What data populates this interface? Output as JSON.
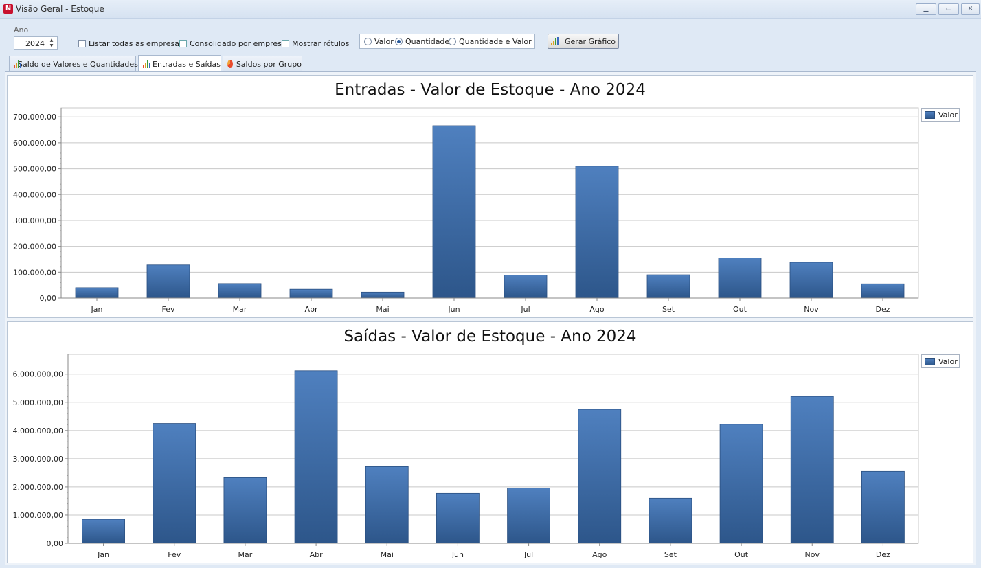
{
  "window": {
    "title": "Visão Geral - Estoque",
    "controls": [
      "minimize",
      "restore",
      "close"
    ]
  },
  "toolbar": {
    "year_label": "Ano",
    "year_value": "2024",
    "checkboxes": [
      {
        "label": "Listar todas as empresas",
        "checked": false
      },
      {
        "label": "Consolidado por empresa",
        "checked": false
      },
      {
        "label": "Mostrar rótulos",
        "checked": false
      }
    ],
    "radios": [
      {
        "label": "Valor",
        "selected": false
      },
      {
        "label": "Quantidade",
        "selected": true
      },
      {
        "label": "Quantidade e Valor",
        "selected": false
      }
    ],
    "generate_label": "Gerar Gráfico"
  },
  "tabs": [
    {
      "label": "Saldo de Valores e Quantidades",
      "icon": "bar-chart-icon",
      "active": false
    },
    {
      "label": "Entradas e Saídas",
      "icon": "bar-chart-icon",
      "active": true
    },
    {
      "label": "Saldos por Grupo",
      "icon": "pie-chart-icon",
      "active": false
    }
  ],
  "colors": {
    "bar_top": "#4f80bf",
    "bar_bottom": "#2d568a",
    "grid": "#c8c8c8"
  },
  "chart_data": [
    {
      "type": "bar",
      "title": "Entradas - Valor de Estoque - Ano 2024",
      "categories": [
        "Jan",
        "Fev",
        "Mar",
        "Abr",
        "Mai",
        "Jun",
        "Jul",
        "Ago",
        "Set",
        "Out",
        "Nov",
        "Dez"
      ],
      "series": [
        {
          "name": "Valor",
          "values": [
            40000,
            128000,
            56000,
            34000,
            23000,
            666000,
            89000,
            510000,
            90000,
            155000,
            138000,
            55000
          ]
        }
      ],
      "yticks": [
        "0,00",
        "100.000,00",
        "200.000,00",
        "300.000,00",
        "400.000,00",
        "500.000,00",
        "600.000,00",
        "700.000,00"
      ],
      "ylim": [
        0,
        735000
      ],
      "grid": true,
      "legend": "top-right"
    },
    {
      "type": "bar",
      "title": "Saídas - Valor de Estoque - Ano 2024",
      "categories": [
        "Jan",
        "Fev",
        "Mar",
        "Abr",
        "Mai",
        "Jun",
        "Jul",
        "Ago",
        "Set",
        "Out",
        "Nov",
        "Dez"
      ],
      "series": [
        {
          "name": "Valor",
          "values": [
            850000,
            4250000,
            2330000,
            6120000,
            2720000,
            1770000,
            1960000,
            4750000,
            1600000,
            4220000,
            5210000,
            2550000
          ]
        }
      ],
      "yticks": [
        "0,00",
        "1.000.000,00",
        "2.000.000,00",
        "3.000.000,00",
        "4.000.000,00",
        "5.000.000,00",
        "6.000.000,00"
      ],
      "ylim": [
        0,
        6700000
      ],
      "grid": true,
      "legend": "top-right"
    }
  ]
}
